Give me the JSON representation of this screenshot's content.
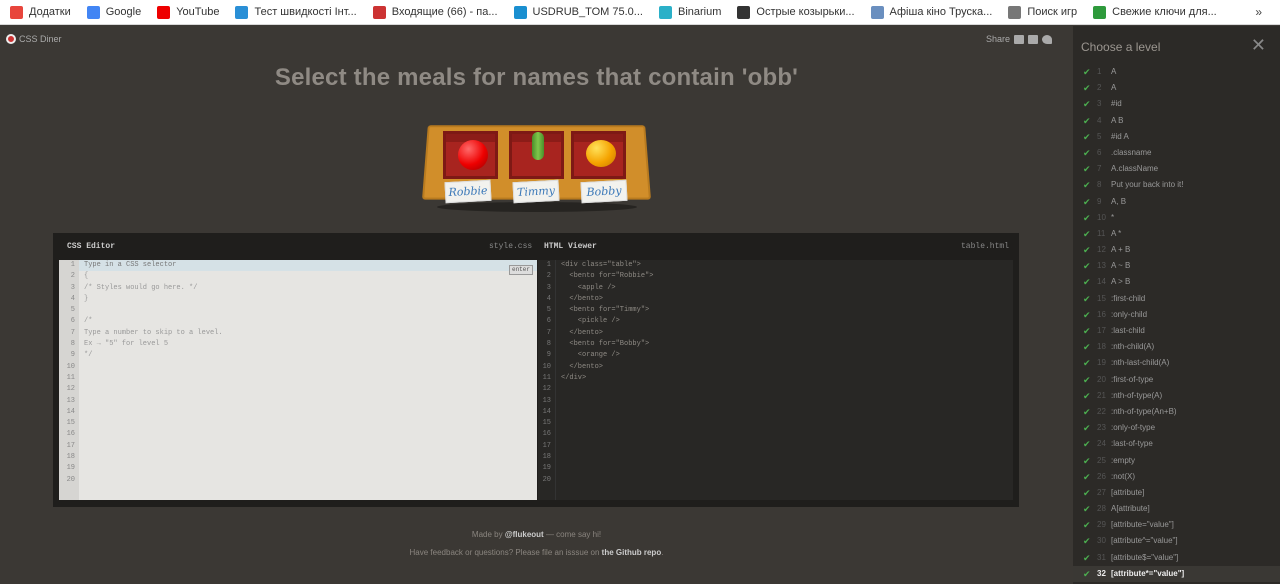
{
  "bookmarks": [
    {
      "label": "Додатки",
      "icon": "apps-grid-icon",
      "color": "#e8453c"
    },
    {
      "label": "Google",
      "icon": "google-icon",
      "color": "#4285f4"
    },
    {
      "label": "YouTube",
      "icon": "youtube-icon",
      "color": "#e00"
    },
    {
      "label": "Тест швидкості Інт...",
      "icon": "speedtest-icon",
      "color": "#2a8fd6"
    },
    {
      "label": "Входящие (66) - па...",
      "icon": "gmail-icon",
      "color": "#c33"
    },
    {
      "label": "USDRUB_TOM 75.0...",
      "icon": "chart-icon",
      "color": "#1a8fd0"
    },
    {
      "label": "Binarium",
      "icon": "binarium-icon",
      "color": "#2bb0c8"
    },
    {
      "label": "Острые козырьки...",
      "icon": "film-icon",
      "color": "#333"
    },
    {
      "label": "Афіша кіно Труска...",
      "icon": "cinema-icon",
      "color": "#6a8fbf"
    },
    {
      "label": "Поиск игр",
      "icon": "games-icon",
      "color": "#777"
    },
    {
      "label": "Свежие ключи для...",
      "icon": "key-site-icon",
      "color": "#2e9a3c"
    }
  ],
  "bookmarks_more": "»",
  "app": {
    "logo": "CSS Diner",
    "share": "Share"
  },
  "instruction": "Select the meals for names that contain 'obb'",
  "table": {
    "bentos": [
      {
        "name": "Robbie",
        "food": "apple"
      },
      {
        "name": "Timmy",
        "food": "pickle"
      },
      {
        "name": "Bobby",
        "food": "orange"
      }
    ]
  },
  "css_editor": {
    "title": "CSS Editor",
    "file": "style.css",
    "placeholder": "Type in a CSS selector",
    "enter": "enter",
    "lines": [
      "",
      "{",
      "/* Styles would go here. */",
      "}",
      "",
      "/*",
      "Type a number to skip to a level.",
      "Ex → \"5\" for level 5",
      "*/",
      "",
      "",
      "",
      "",
      "",
      "",
      "",
      "",
      "",
      "",
      ""
    ]
  },
  "html_viewer": {
    "title": "HTML Viewer",
    "file": "table.html",
    "lines": [
      "<div class=\"table\">",
      "  <bento for=\"Robbie\">",
      "    <apple />",
      "  </bento>",
      "  <bento for=\"Timmy\">",
      "    <pickle />",
      "  </bento>",
      "  <bento for=\"Bobby\">",
      "    <orange />",
      "  </bento>",
      "</div>",
      "",
      "",
      "",
      "",
      "",
      "",
      "",
      "",
      ""
    ]
  },
  "footer": {
    "line1_pre": "Made by ",
    "line1_author": "@flukeout",
    "line1_post": " — come say hi!",
    "line2_pre": "Have feedback or questions? Please file an isssue on ",
    "line2_link": "the Github repo",
    "line2_post": "."
  },
  "sidebar": {
    "title": "Choose a level",
    "current": 32,
    "levels": [
      "A",
      "A",
      "#id",
      "A B",
      "#id A",
      ".classname",
      "A.className",
      "Put your back into it!",
      "A, B",
      "*",
      "A *",
      "A + B",
      "A ~ B",
      "A > B",
      ":first-child",
      ":only-child",
      ":last-child",
      ":nth-child(A)",
      ":nth-last-child(A)",
      ":first-of-type",
      ":nth-of-type(A)",
      ":nth-of-type(An+B)",
      ":only-of-type",
      ":last-of-type",
      ":empty",
      ":not(X)",
      "[attribute]",
      "A[attribute]",
      "[attribute=\"value\"]",
      "[attribute^=\"value\"]",
      "[attribute$=\"value\"]",
      "[attribute*=\"value\"]"
    ]
  }
}
